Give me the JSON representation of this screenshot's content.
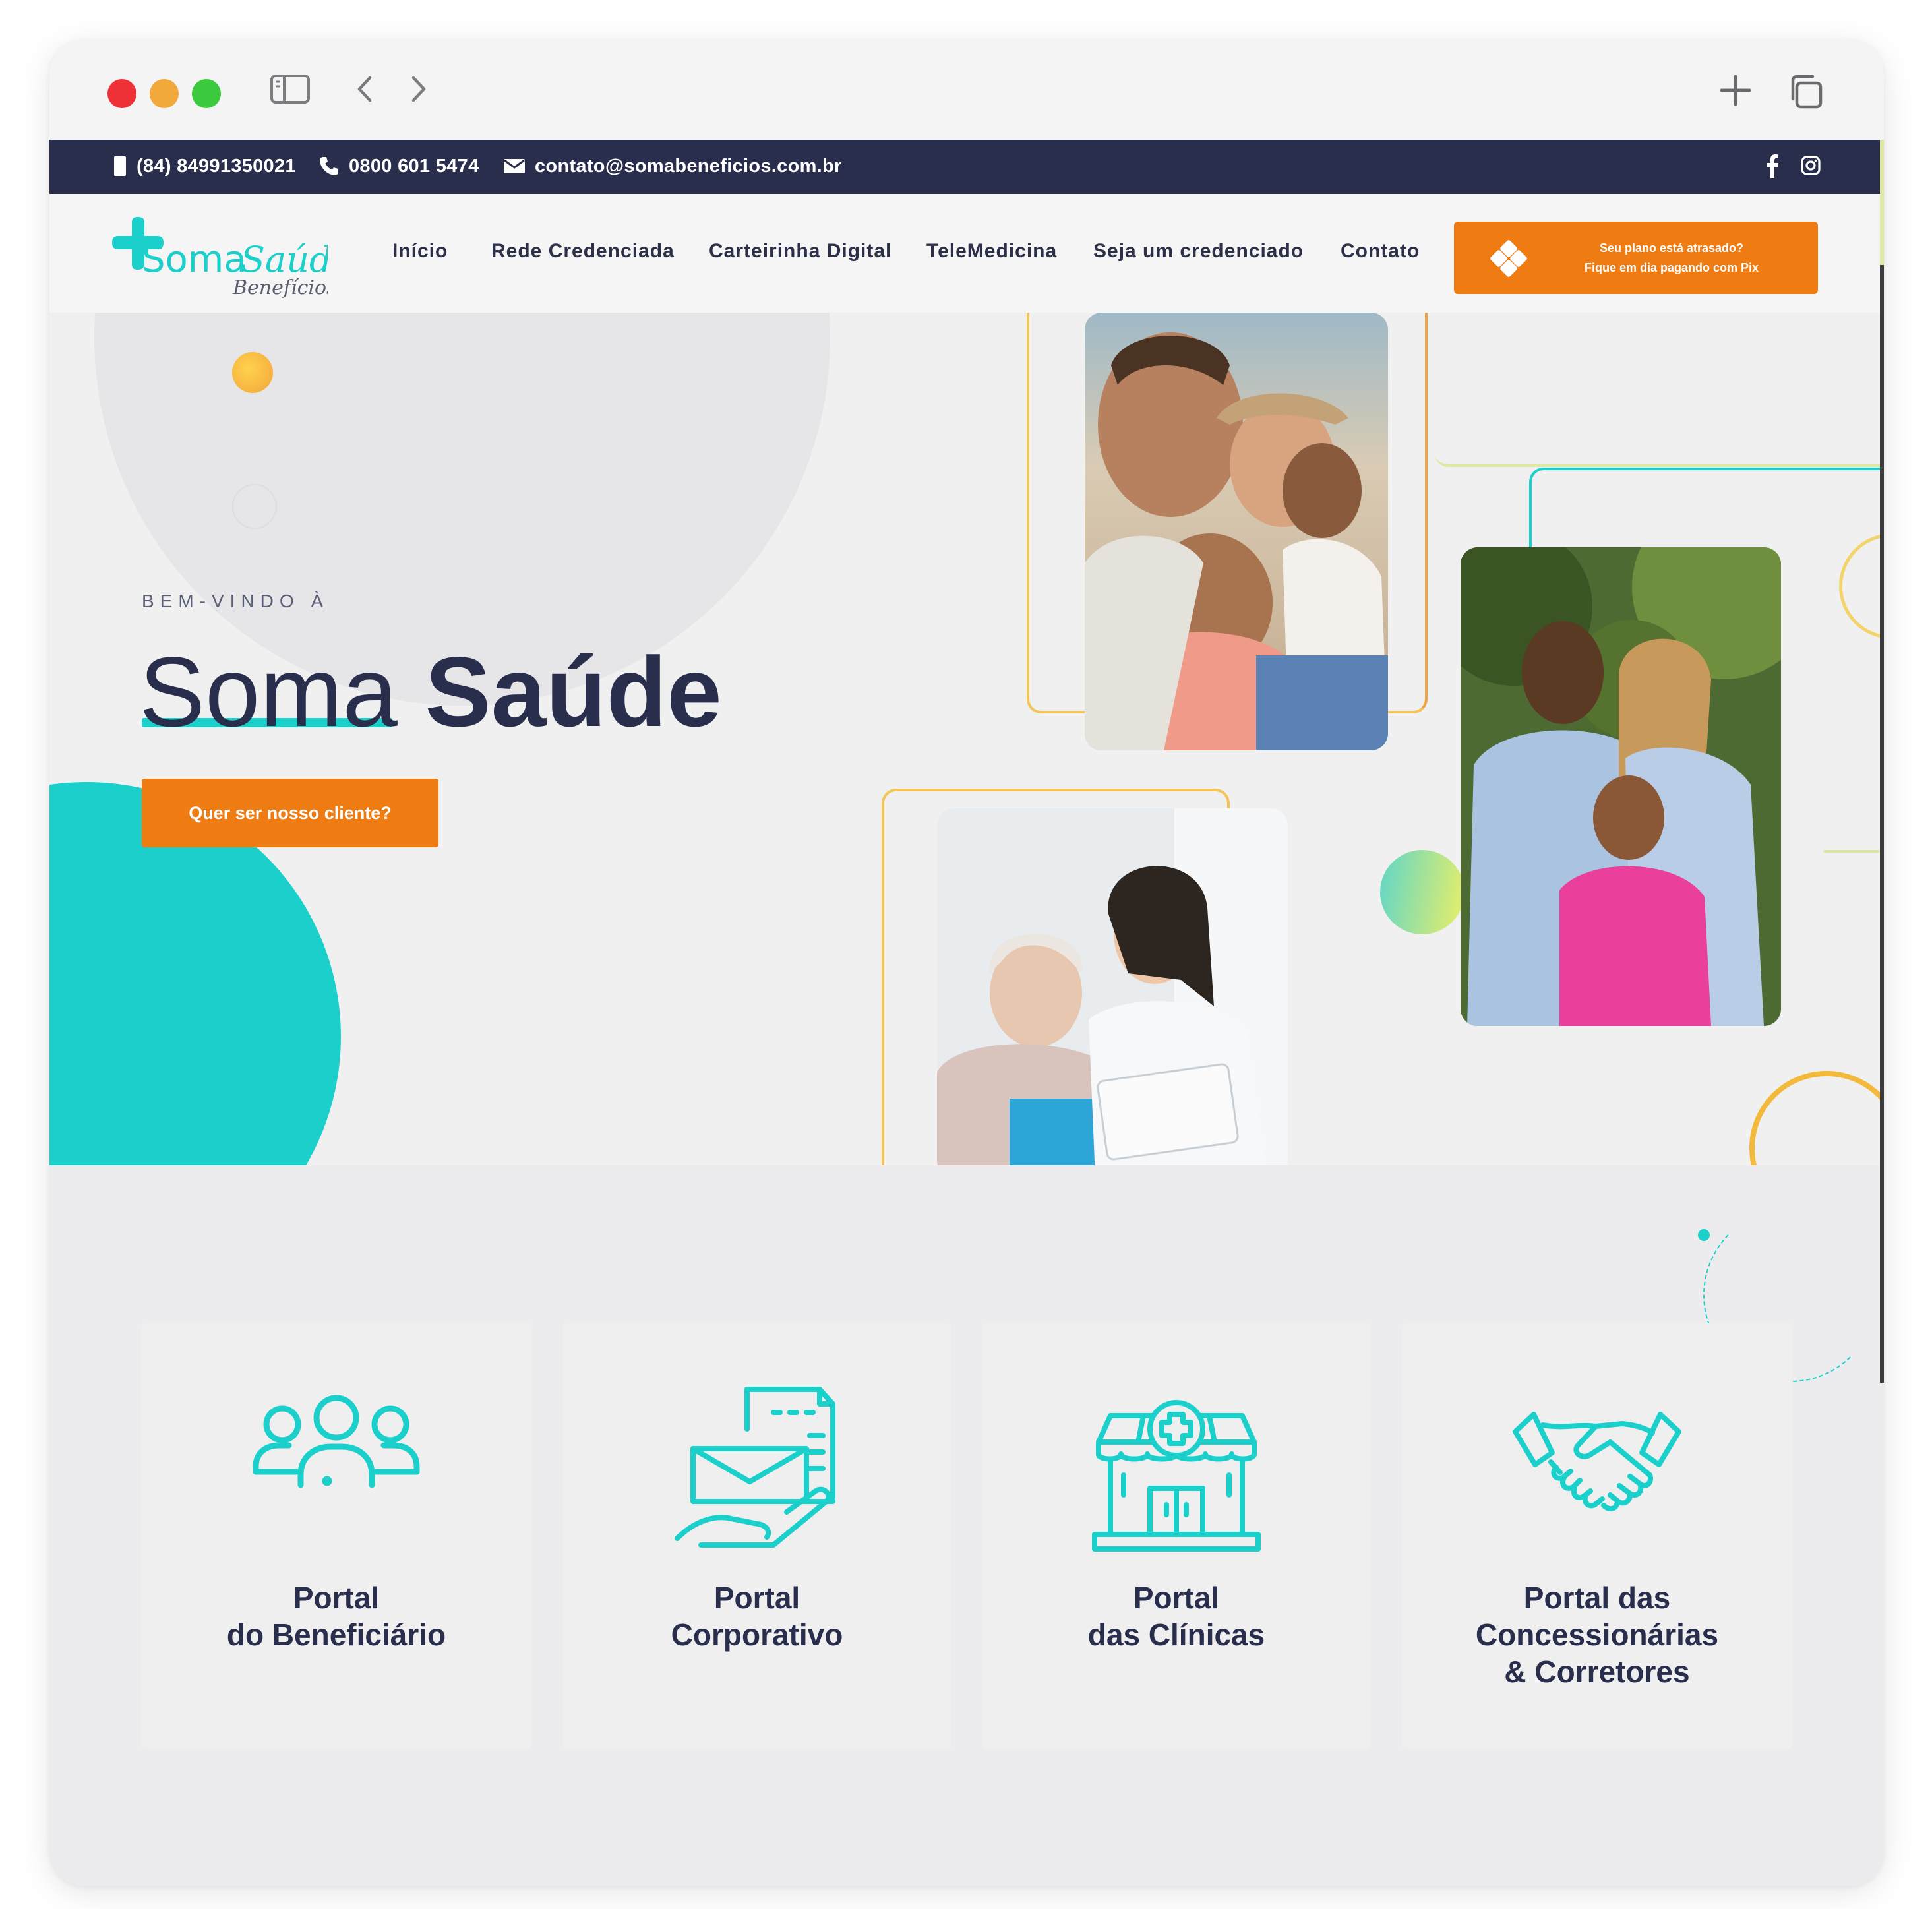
{
  "topbar": {
    "phone1": "(84) 84991350021",
    "phone2": "0800 601 5474",
    "email": "contato@somabeneficios.com.br"
  },
  "logo": {
    "name_part1": "Soma",
    "name_part2": "Saúde",
    "tagline": "Benefícios"
  },
  "nav": {
    "items": [
      "Início",
      "Rede Credenciada",
      "Carteirinha Digital",
      "TeleMedicina",
      "Seja um credenciado",
      "Contato"
    ],
    "pix_line1": "Seu plano está atrasado?",
    "pix_line2": "Fique em dia pagando com Pix"
  },
  "hero": {
    "eyebrow": "BEM-VINDO À",
    "title_light": "Soma",
    "title_bold": "Saúde",
    "cta": "Quer ser nosso cliente?"
  },
  "portals": [
    {
      "line1": "Portal",
      "line2": "do Beneficiário",
      "line3": "",
      "icon": "people-group-icon"
    },
    {
      "line1": "Portal",
      "line2": "Corporativo",
      "line3": "",
      "icon": "document-hand-icon"
    },
    {
      "line1": "Portal",
      "line2": "das Clínicas",
      "line3": "",
      "icon": "clinic-building-icon"
    },
    {
      "line1": "Portal das",
      "line2": "Concessionárias",
      "line3": "& Corretores",
      "icon": "handshake-icon"
    }
  ],
  "colors": {
    "navy": "#2a2e4d",
    "teal": "#1bd0cb",
    "orange": "#ef7c12",
    "yellow": "#f2b93b"
  }
}
